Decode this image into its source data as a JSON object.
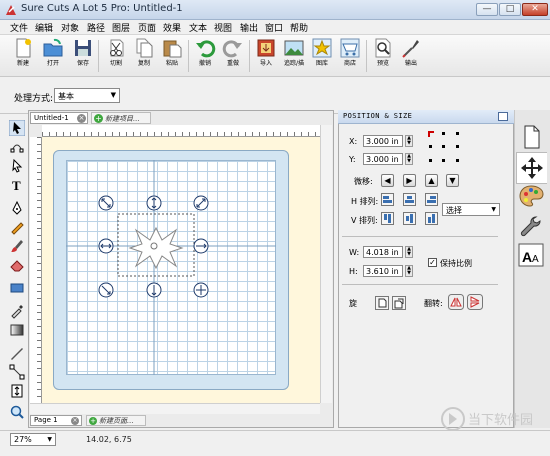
{
  "window": {
    "title": "Sure Cuts A Lot 5 Pro: Untitled-1",
    "min": "—",
    "max": "□",
    "close": "✕"
  },
  "menu": [
    "文件",
    "编辑",
    "对象",
    "路径",
    "图层",
    "页面",
    "效果",
    "文本",
    "视图",
    "输出",
    "窗口",
    "帮助"
  ],
  "toolbar": {
    "new": "新建",
    "open": "打开",
    "save": "保存",
    "cut": "切割",
    "copy": "复制",
    "paste": "粘贴",
    "undo": "撤销",
    "redo": "重做",
    "import": "导入",
    "trace": "追踪/描",
    "shapes": "图库",
    "store": "商店",
    "preview": "预览",
    "output": "输出"
  },
  "mode": {
    "label": "处理方式:",
    "value": "基本"
  },
  "canvas": {
    "doc_tab": "Untitled-1",
    "new_doc_tab": "新建项目...",
    "page_tab": "Page 1",
    "new_page_tab": "新建页面..."
  },
  "panel": {
    "title": "POSITION & SIZE",
    "x_label": "X:",
    "x_value": "3.000 in",
    "y_label": "Y:",
    "y_value": "3.000 in",
    "nudge_label": "微移:",
    "h_align_label": "H 排列:",
    "v_align_label": "V 排列:",
    "align_select": "选择",
    "w_label": "W:",
    "w_value": "4.018 in",
    "h_label": "H:",
    "h_value": "3.610 in",
    "keep_ratio": "保持比例",
    "rotate_label": "旋",
    "flip_label": "翻转:"
  },
  "status": {
    "zoom": "27%",
    "coords": "14.02, 6.75"
  },
  "watermark": {
    "text": "当下软件园"
  },
  "colors": {
    "accent": "#3fa73f",
    "mat": "#d3e5f2",
    "design_bg": "#fff7dc"
  }
}
